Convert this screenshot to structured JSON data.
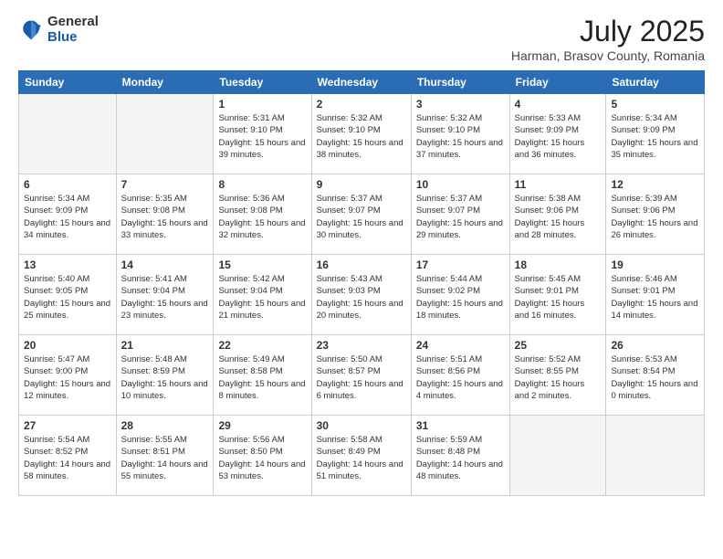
{
  "header": {
    "logo_general": "General",
    "logo_blue": "Blue",
    "title": "July 2025",
    "subtitle": "Harman, Brasov County, Romania"
  },
  "days_of_week": [
    "Sunday",
    "Monday",
    "Tuesday",
    "Wednesday",
    "Thursday",
    "Friday",
    "Saturday"
  ],
  "weeks": [
    [
      {
        "day": "",
        "info": ""
      },
      {
        "day": "",
        "info": ""
      },
      {
        "day": "1",
        "info": "Sunrise: 5:31 AM\nSunset: 9:10 PM\nDaylight: 15 hours and 39 minutes."
      },
      {
        "day": "2",
        "info": "Sunrise: 5:32 AM\nSunset: 9:10 PM\nDaylight: 15 hours and 38 minutes."
      },
      {
        "day": "3",
        "info": "Sunrise: 5:32 AM\nSunset: 9:10 PM\nDaylight: 15 hours and 37 minutes."
      },
      {
        "day": "4",
        "info": "Sunrise: 5:33 AM\nSunset: 9:09 PM\nDaylight: 15 hours and 36 minutes."
      },
      {
        "day": "5",
        "info": "Sunrise: 5:34 AM\nSunset: 9:09 PM\nDaylight: 15 hours and 35 minutes."
      }
    ],
    [
      {
        "day": "6",
        "info": "Sunrise: 5:34 AM\nSunset: 9:09 PM\nDaylight: 15 hours and 34 minutes."
      },
      {
        "day": "7",
        "info": "Sunrise: 5:35 AM\nSunset: 9:08 PM\nDaylight: 15 hours and 33 minutes."
      },
      {
        "day": "8",
        "info": "Sunrise: 5:36 AM\nSunset: 9:08 PM\nDaylight: 15 hours and 32 minutes."
      },
      {
        "day": "9",
        "info": "Sunrise: 5:37 AM\nSunset: 9:07 PM\nDaylight: 15 hours and 30 minutes."
      },
      {
        "day": "10",
        "info": "Sunrise: 5:37 AM\nSunset: 9:07 PM\nDaylight: 15 hours and 29 minutes."
      },
      {
        "day": "11",
        "info": "Sunrise: 5:38 AM\nSunset: 9:06 PM\nDaylight: 15 hours and 28 minutes."
      },
      {
        "day": "12",
        "info": "Sunrise: 5:39 AM\nSunset: 9:06 PM\nDaylight: 15 hours and 26 minutes."
      }
    ],
    [
      {
        "day": "13",
        "info": "Sunrise: 5:40 AM\nSunset: 9:05 PM\nDaylight: 15 hours and 25 minutes."
      },
      {
        "day": "14",
        "info": "Sunrise: 5:41 AM\nSunset: 9:04 PM\nDaylight: 15 hours and 23 minutes."
      },
      {
        "day": "15",
        "info": "Sunrise: 5:42 AM\nSunset: 9:04 PM\nDaylight: 15 hours and 21 minutes."
      },
      {
        "day": "16",
        "info": "Sunrise: 5:43 AM\nSunset: 9:03 PM\nDaylight: 15 hours and 20 minutes."
      },
      {
        "day": "17",
        "info": "Sunrise: 5:44 AM\nSunset: 9:02 PM\nDaylight: 15 hours and 18 minutes."
      },
      {
        "day": "18",
        "info": "Sunrise: 5:45 AM\nSunset: 9:01 PM\nDaylight: 15 hours and 16 minutes."
      },
      {
        "day": "19",
        "info": "Sunrise: 5:46 AM\nSunset: 9:01 PM\nDaylight: 15 hours and 14 minutes."
      }
    ],
    [
      {
        "day": "20",
        "info": "Sunrise: 5:47 AM\nSunset: 9:00 PM\nDaylight: 15 hours and 12 minutes."
      },
      {
        "day": "21",
        "info": "Sunrise: 5:48 AM\nSunset: 8:59 PM\nDaylight: 15 hours and 10 minutes."
      },
      {
        "day": "22",
        "info": "Sunrise: 5:49 AM\nSunset: 8:58 PM\nDaylight: 15 hours and 8 minutes."
      },
      {
        "day": "23",
        "info": "Sunrise: 5:50 AM\nSunset: 8:57 PM\nDaylight: 15 hours and 6 minutes."
      },
      {
        "day": "24",
        "info": "Sunrise: 5:51 AM\nSunset: 8:56 PM\nDaylight: 15 hours and 4 minutes."
      },
      {
        "day": "25",
        "info": "Sunrise: 5:52 AM\nSunset: 8:55 PM\nDaylight: 15 hours and 2 minutes."
      },
      {
        "day": "26",
        "info": "Sunrise: 5:53 AM\nSunset: 8:54 PM\nDaylight: 15 hours and 0 minutes."
      }
    ],
    [
      {
        "day": "27",
        "info": "Sunrise: 5:54 AM\nSunset: 8:52 PM\nDaylight: 14 hours and 58 minutes."
      },
      {
        "day": "28",
        "info": "Sunrise: 5:55 AM\nSunset: 8:51 PM\nDaylight: 14 hours and 55 minutes."
      },
      {
        "day": "29",
        "info": "Sunrise: 5:56 AM\nSunset: 8:50 PM\nDaylight: 14 hours and 53 minutes."
      },
      {
        "day": "30",
        "info": "Sunrise: 5:58 AM\nSunset: 8:49 PM\nDaylight: 14 hours and 51 minutes."
      },
      {
        "day": "31",
        "info": "Sunrise: 5:59 AM\nSunset: 8:48 PM\nDaylight: 14 hours and 48 minutes."
      },
      {
        "day": "",
        "info": ""
      },
      {
        "day": "",
        "info": ""
      }
    ]
  ]
}
